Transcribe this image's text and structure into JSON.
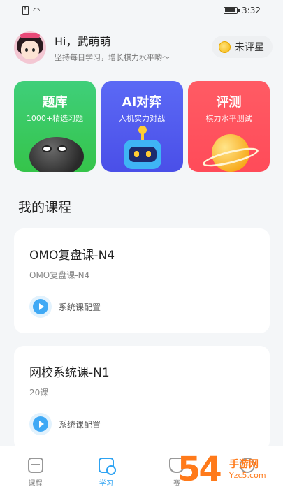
{
  "status_bar": {
    "time": "3:32"
  },
  "profile": {
    "greeting": "Hi，武萌萌",
    "subtitle": "坚持每日学习，增长棋力水平哟～",
    "rating_badge": "未评星"
  },
  "feature_cards": [
    {
      "title": "题库",
      "subtitle": "1000+精选习题"
    },
    {
      "title": "AI对弈",
      "subtitle": "人机实力对战"
    },
    {
      "title": "评测",
      "subtitle": "棋力水平测试"
    }
  ],
  "section_title": "我的课程",
  "courses": [
    {
      "title": "OMO复盘课-N4",
      "subtitle": "OMO复盘课-N4",
      "config_label": "系统课配置"
    },
    {
      "title": "网校系统课-N1",
      "subtitle": "20课",
      "config_label": "系统课配置"
    }
  ],
  "tabs": [
    {
      "label": "课程",
      "active": false
    },
    {
      "label": "学习",
      "active": true
    },
    {
      "label": "赛",
      "active": false
    },
    {
      "label": "",
      "active": false
    }
  ],
  "watermark": {
    "big": "54",
    "brand": "手游网",
    "url": "Yzc5.com"
  },
  "colors": {
    "accent": "#2ea3f2",
    "green": "#35c44a",
    "blue": "#4a4fe8",
    "red": "#ff4b59"
  }
}
